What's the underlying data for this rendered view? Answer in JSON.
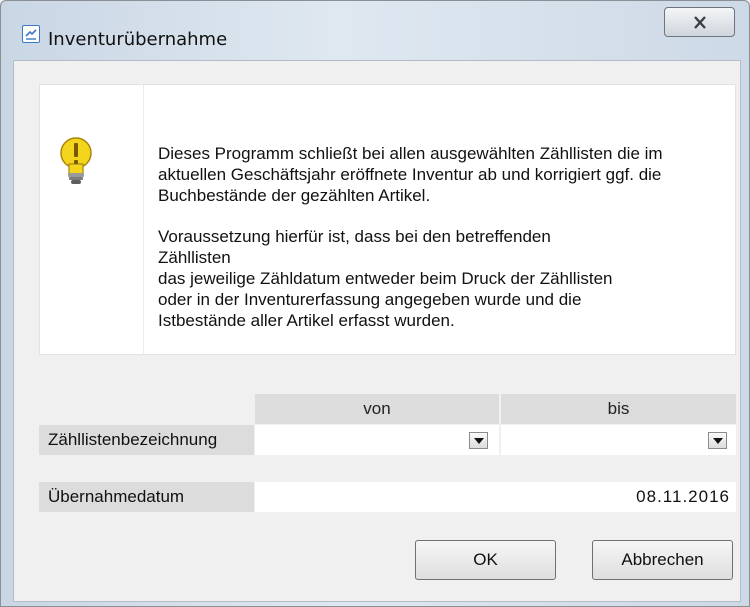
{
  "window": {
    "title": "Inventurübernahme",
    "app_icon": "chart-window-icon",
    "close_icon": "close-icon"
  },
  "info": {
    "icon": "lightbulb-warning-icon",
    "paragraph1": "Dieses Programm schließt bei allen ausgewählten Zähllisten die im aktuellen Geschäftsjahr eröffnete Inventur ab und korrigiert ggf. die Buchbestände der gezählten Artikel.",
    "paragraph2_lines": [
      "Voraussetzung hierfür ist, dass bei den betreffenden",
      "Zähllisten",
      "das jeweilige Zähldatum entweder beim Druck der Zähllisten",
      "oder in der Inventurerfassung angegeben wurde und die",
      "Istbestände aller Artikel erfasst wurden."
    ]
  },
  "range": {
    "header_from": "von",
    "header_to": "bis",
    "label": "Zähllistenbezeichnung",
    "from_value": "",
    "to_value": ""
  },
  "transfer_date": {
    "label": "Übernahmedatum",
    "value": "08.11.2016"
  },
  "buttons": {
    "ok": "OK",
    "cancel": "Abbrechen"
  },
  "colors": {
    "title_icon_border": "#3b79c6",
    "header_bg": "#dcdcdc",
    "bulb_fill": "#f4d51e"
  }
}
